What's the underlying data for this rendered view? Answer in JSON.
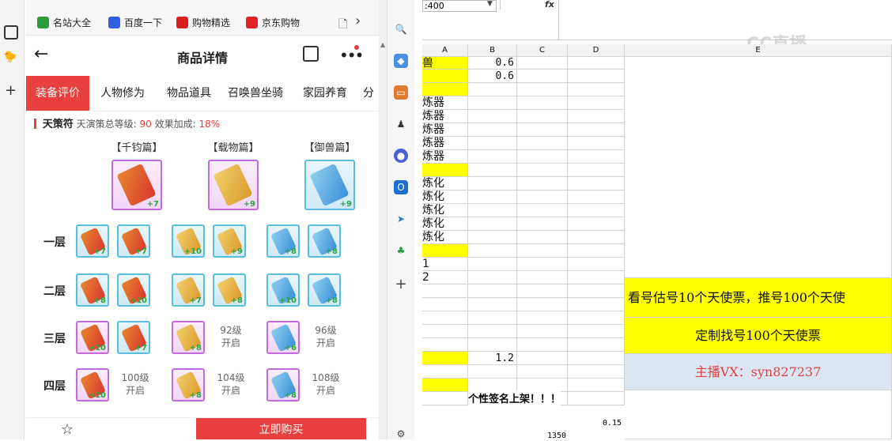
{
  "bookmarks": [
    {
      "label": "名站大全",
      "icon": "globe-icon",
      "color": "#2a9d3a"
    },
    {
      "label": "百度一下",
      "icon": "baidu-icon",
      "color": "#3060e0"
    },
    {
      "label": "购物精选",
      "icon": "tmall-icon",
      "color": "#d92020"
    },
    {
      "label": "京东购物",
      "icon": "jd-icon",
      "color": "#e0232a"
    }
  ],
  "header": {
    "title": "商品详情"
  },
  "tabs": [
    "装备评价",
    "人物修为",
    "物品道具",
    "召唤兽坐骑",
    "家园养育",
    "分"
  ],
  "subhead": {
    "name": "天策符",
    "level_label": "天演策总等级:",
    "level_value": "90",
    "bonus_label": "效果加成:",
    "bonus_value": "18%"
  },
  "categories": [
    "【千钧篇】",
    "【载物篇】",
    "【御兽篇】"
  ],
  "top_items": [
    {
      "plus": "+7",
      "frame": "purple",
      "kind": "red"
    },
    {
      "plus": "+9",
      "frame": "purple",
      "kind": "gold"
    },
    {
      "plus": "+9",
      "frame": "blue",
      "kind": "bluez"
    }
  ],
  "rows": [
    {
      "label": "一层",
      "items": [
        {
          "plus": "+7",
          "frame": "blue",
          "kind": "red"
        },
        {
          "plus": "+7",
          "frame": "blue",
          "kind": "red"
        },
        {
          "plus": "+10",
          "frame": "blue",
          "kind": "gold"
        },
        {
          "plus": "+9",
          "frame": "blue",
          "kind": "gold"
        },
        {
          "plus": "+8",
          "frame": "blue",
          "kind": "bluez"
        },
        {
          "plus": "+8",
          "frame": "blue",
          "kind": "bluez"
        }
      ]
    },
    {
      "label": "二层",
      "items": [
        {
          "plus": "+8",
          "frame": "blue",
          "kind": "red"
        },
        {
          "plus": "+10",
          "frame": "blue",
          "kind": "red"
        },
        {
          "plus": "+7",
          "frame": "blue",
          "kind": "gold"
        },
        {
          "plus": "+8",
          "frame": "blue",
          "kind": "gold"
        },
        {
          "plus": "+10",
          "frame": "blue",
          "kind": "bluez"
        },
        {
          "plus": "+8",
          "frame": "blue",
          "kind": "bluez"
        }
      ]
    },
    {
      "label": "三层",
      "items": [
        {
          "plus": "+10",
          "frame": "purple",
          "kind": "red"
        },
        {
          "plus": "+7",
          "frame": "blue",
          "kind": "red"
        },
        {
          "plus": "+8",
          "frame": "purple",
          "kind": "gold"
        },
        {
          "locked": "92级\n开启"
        },
        {
          "plus": "+6",
          "frame": "purple",
          "kind": "bluez"
        },
        {
          "locked": "96级\n开启"
        }
      ]
    },
    {
      "label": "四层",
      "items": [
        {
          "plus": "+10",
          "frame": "purple",
          "kind": "red"
        },
        {
          "locked": "100级\n开启"
        },
        {
          "plus": "+8",
          "frame": "purple",
          "kind": "gold"
        },
        {
          "locked": "104级\n开启"
        },
        {
          "plus": "+8",
          "frame": "purple",
          "kind": "bluez"
        },
        {
          "locked": "108级\n开启"
        }
      ]
    }
  ],
  "bottom": {
    "buy_label": "立即购买"
  },
  "sheet": {
    "cellref": ":400",
    "fx": "fx",
    "col_headers": [
      "A",
      "B",
      "C",
      "D",
      "E"
    ],
    "watermark": "CC直播",
    "colA": [
      "兽",
      "",
      "",
      "炼器",
      "炼器",
      "炼器",
      "炼器",
      "炼器",
      "",
      "炼化",
      "炼化",
      "炼化",
      "炼化",
      "炼化",
      "",
      "1",
      "2",
      "",
      "",
      "",
      "",
      "",
      "",
      "",
      "",
      ""
    ],
    "b_values": {
      "r0": "0.6",
      "r1": "0.6",
      "r22": "1.2"
    },
    "promo1": "看号估号10个天使票，推号100个天使",
    "promo2": "定制找号100个天使票",
    "promo3": "主播VX：syn827237",
    "footer_text": "个性签名上架！！！",
    "val_015": "0.15",
    "val_1350": "1350"
  }
}
